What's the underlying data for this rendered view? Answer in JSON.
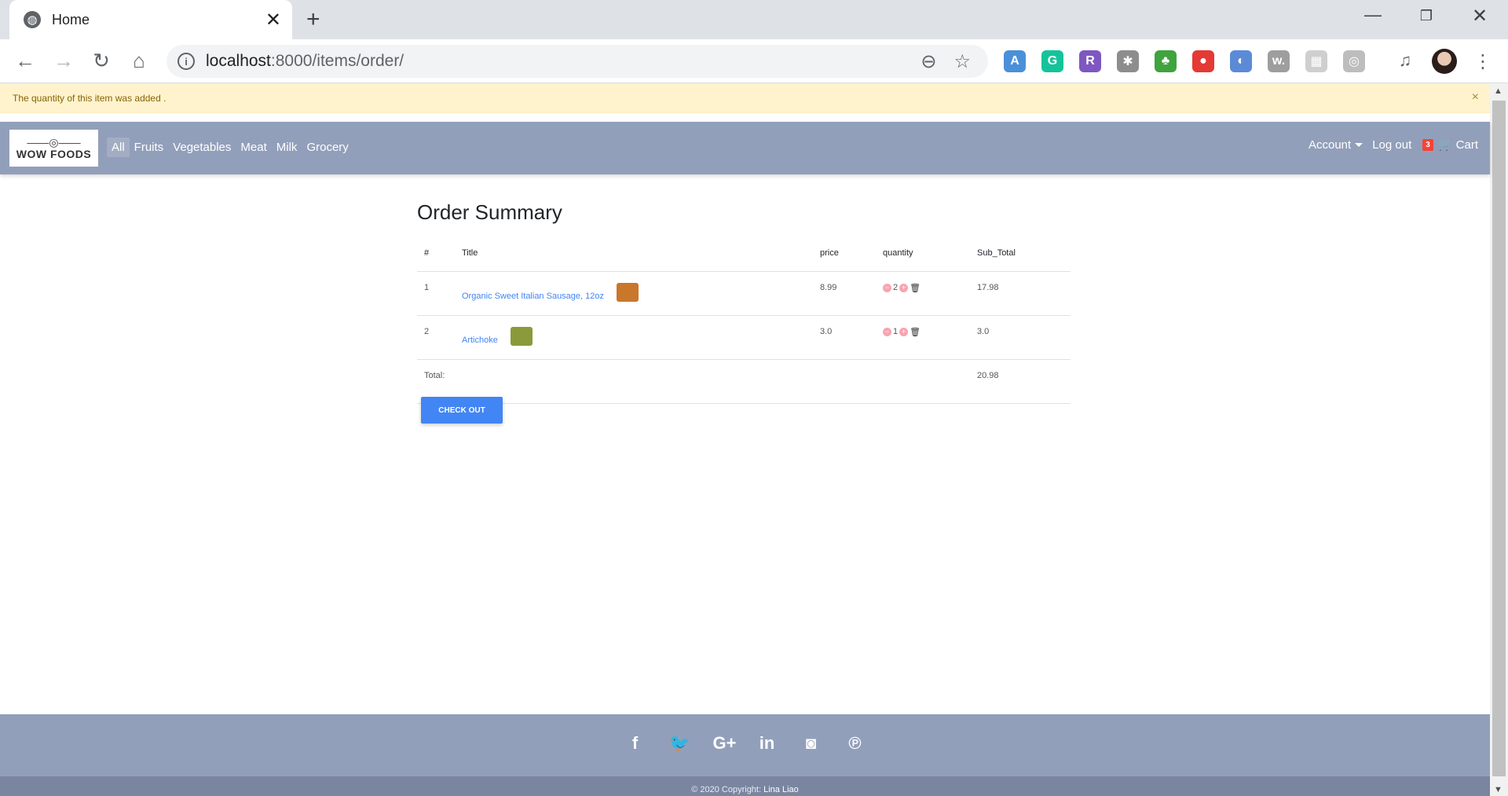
{
  "browser": {
    "tab_title": "Home",
    "url_host": "localhost",
    "url_path": ":8000/items/order/",
    "extensions": [
      {
        "name": "a-icon",
        "glyph": "A",
        "color": "#4a90d9"
      },
      {
        "name": "grammarly-icon",
        "glyph": "G",
        "color": "#15c39a"
      },
      {
        "name": "r-icon",
        "glyph": "R",
        "color": "#7e57c2"
      },
      {
        "name": "bug-icon",
        "glyph": "✱",
        "color": "#8d8d8d"
      },
      {
        "name": "html-tree-icon",
        "glyph": "♣",
        "color": "#3fa33f"
      },
      {
        "name": "color-wheel-icon",
        "glyph": "●",
        "color": "#e53935"
      },
      {
        "name": "drop-icon",
        "glyph": "◐",
        "color": "#5b8bd6"
      },
      {
        "name": "w-icon",
        "glyph": "w.",
        "color": "#9e9e9e"
      },
      {
        "name": "grid-icon",
        "glyph": "▦",
        "color": "#cfcfcf"
      },
      {
        "name": "circle-icon",
        "glyph": "◎",
        "color": "#bdbdbd"
      }
    ]
  },
  "alert": {
    "message": "The quantity of this item was added .",
    "close": "×"
  },
  "site": {
    "logo_mark": "——◎——",
    "logo_text": "WOW FOODS",
    "nav": [
      "All",
      "Fruits",
      "Vegetables",
      "Meat",
      "Milk",
      "Grocery"
    ],
    "account": "Account",
    "logout": "Log out",
    "cart_count": "3",
    "cart": "Cart"
  },
  "order": {
    "title": "Order Summary",
    "headers": [
      "#",
      "Title",
      "price",
      "quantity",
      "Sub_Total"
    ],
    "rows": [
      {
        "num": "1",
        "title": "Organic Sweet Italian Sausage, 12oz",
        "price": "8.99",
        "qty": "2",
        "subtotal": "17.98",
        "img_color": "#c9772a"
      },
      {
        "num": "2",
        "title": "Artichoke",
        "price": "3.0",
        "qty": "1",
        "subtotal": "3.0",
        "img_color": "#8a9a3a"
      }
    ],
    "total_label": "Total:",
    "total": "20.98",
    "checkout": "CHECK OUT"
  },
  "footer": {
    "social": [
      {
        "name": "facebook-icon",
        "glyph": "f"
      },
      {
        "name": "twitter-icon",
        "glyph": "🐦"
      },
      {
        "name": "google-plus-icon",
        "glyph": "G+"
      },
      {
        "name": "linkedin-icon",
        "glyph": "in"
      },
      {
        "name": "instagram-icon",
        "glyph": "◙"
      },
      {
        "name": "pinterest-icon",
        "glyph": "℗"
      }
    ],
    "copyright_prefix": "© 2020 Copyright:",
    "copyright_author": "Lina Liao"
  }
}
